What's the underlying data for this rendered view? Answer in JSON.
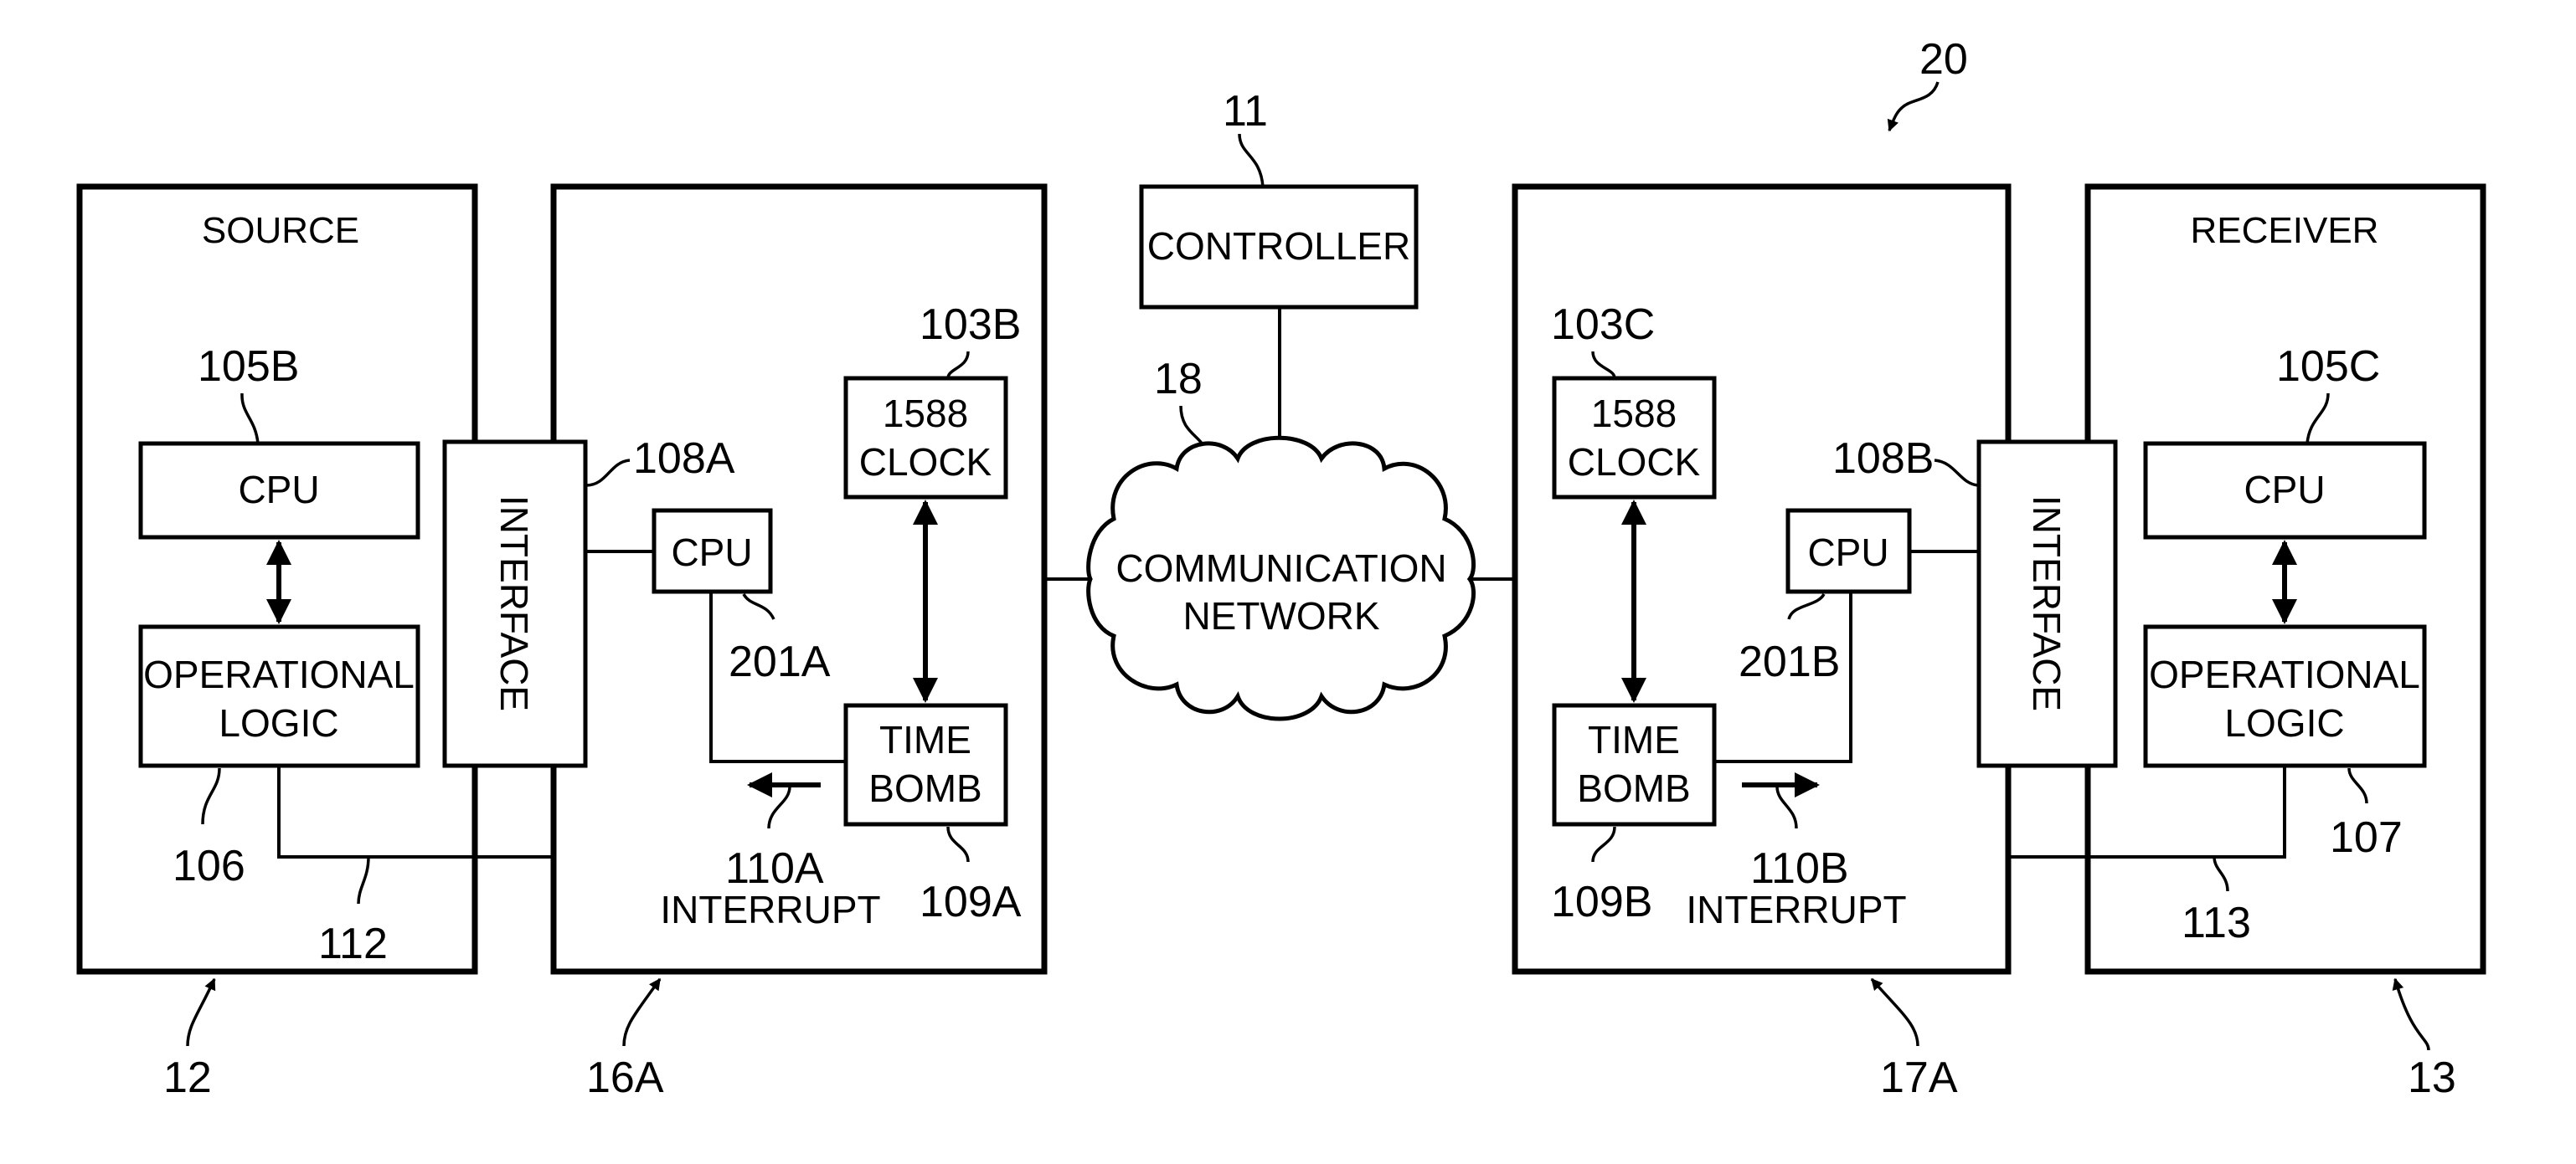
{
  "figure": {
    "system_ref": "20",
    "controller": {
      "label": "CONTROLLER",
      "ref": "11"
    },
    "network": {
      "label_line1": "COMMUNICATION",
      "label_line2": "NETWORK",
      "ref": "18"
    },
    "source": {
      "title": "SOURCE",
      "ref": "12",
      "cpu": {
        "label": "CPU",
        "ref": "105B"
      },
      "logic": {
        "label_line1": "OPERATIONAL",
        "label_line2": "LOGIC",
        "ref": "106"
      },
      "bus_ref": "112"
    },
    "node_a": {
      "ref": "16A",
      "interface": {
        "label": "INTERFACE",
        "ref": "108A"
      },
      "cpu": {
        "label": "CPU",
        "ref": "201A"
      },
      "clock": {
        "label_line1": "1588",
        "label_line2": "CLOCK",
        "ref": "103B"
      },
      "timebomb": {
        "label_line1": "TIME",
        "label_line2": "BOMB",
        "ref": "109A"
      },
      "interrupt": {
        "ref": "110A",
        "label": "INTERRUPT"
      }
    },
    "node_b": {
      "ref": "17A",
      "interface": {
        "label": "INTERFACE",
        "ref": "108B"
      },
      "cpu": {
        "label": "CPU",
        "ref": "201B"
      },
      "clock": {
        "label_line1": "1588",
        "label_line2": "CLOCK",
        "ref": "103C"
      },
      "timebomb": {
        "label_line1": "TIME",
        "label_line2": "BOMB",
        "ref": "109B"
      },
      "interrupt": {
        "ref": "110B",
        "label": "INTERRUPT"
      }
    },
    "receiver": {
      "title": "RECEIVER",
      "ref": "13",
      "cpu": {
        "label": "CPU",
        "ref": "105C"
      },
      "logic": {
        "label_line1": "OPERATIONAL",
        "label_line2": "LOGIC",
        "ref": "107"
      },
      "bus_ref": "113"
    }
  }
}
